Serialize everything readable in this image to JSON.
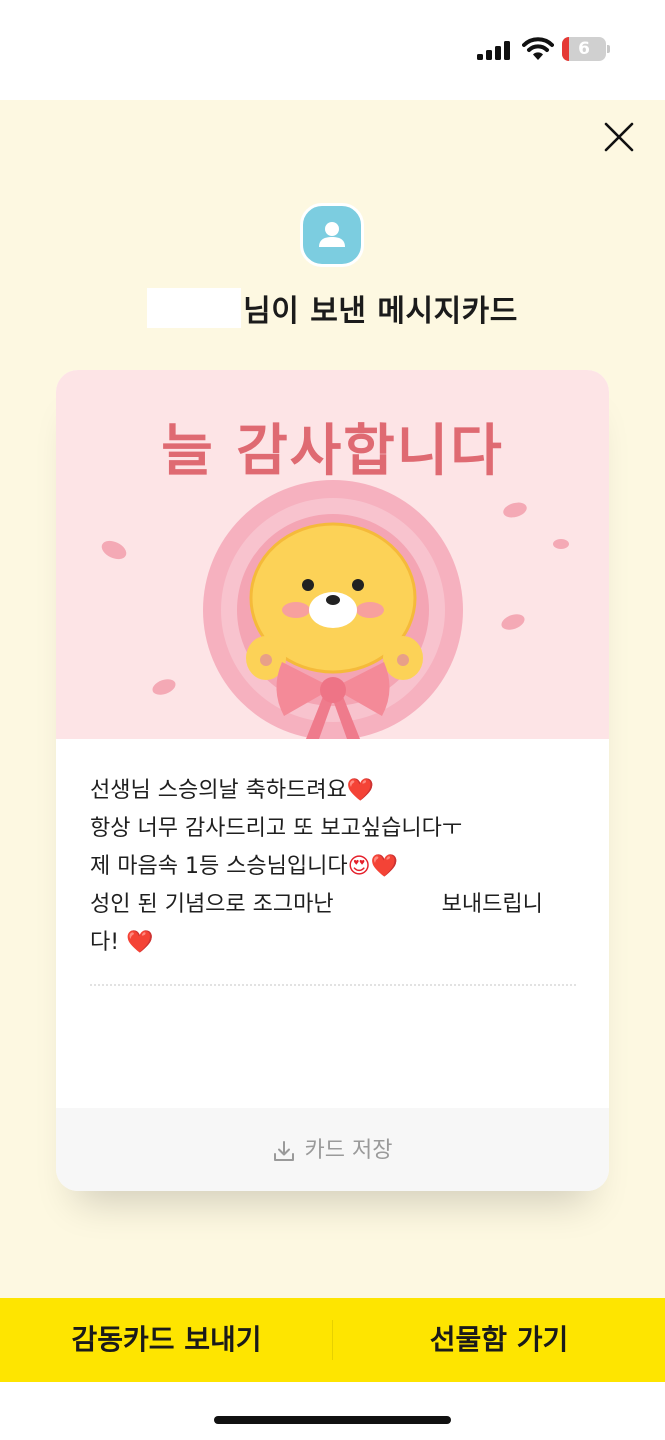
{
  "status_bar": {
    "battery_level": "6",
    "colors": {
      "battery_low": "#e53935"
    }
  },
  "header": {
    "title": "님이 보낸 메시지카드"
  },
  "card": {
    "headline": "늘 감사합니다",
    "message_lines": [
      {
        "text": "선생님 스승의날 축하드려요",
        "emoji": "❤️"
      },
      {
        "text": "항상 너무 감사드리고 또 보고싶습니다ㅜ",
        "emoji": ""
      },
      {
        "text": "제 마음속 1등 스승님입니다",
        "emoji": "😍❤️"
      },
      {
        "text_before": "성인 된 기념으로 조그마난",
        "text_after": "보내드립니"
      },
      {
        "text": "다!",
        "emoji": "❤️"
      }
    ],
    "save_label": "카드 저장",
    "colors": {
      "headline": "#df6a72",
      "background": "#fde4e6"
    }
  },
  "actions": {
    "send_card_label": "감동카드 보내기",
    "gift_box_label": "선물함 가기"
  },
  "icons": {
    "close": "close-icon",
    "avatar": "person-icon",
    "download": "download-icon"
  },
  "colors": {
    "page_background": "#fdf8e1",
    "action_bar": "#fee500",
    "avatar": "#7ccde0"
  }
}
